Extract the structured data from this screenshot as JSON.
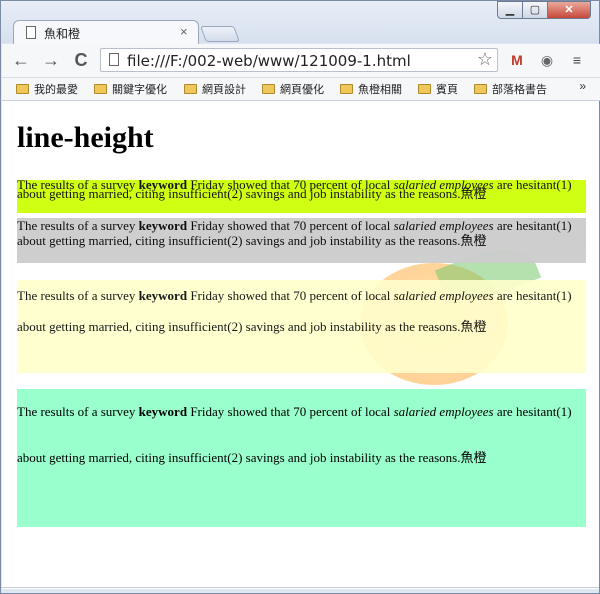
{
  "browser": {
    "tab_title": "魚和橙",
    "tab_close": "×",
    "url": "file:///F:/002-web/www/121009-1.html",
    "window_buttons": {
      "minimize": "▁",
      "maximize": "▢",
      "close": "✕"
    },
    "nav": {
      "back": "←",
      "forward": "→",
      "reload": "C"
    },
    "extensions": [
      "gmail-icon",
      "extension-icon",
      "menu-icon"
    ]
  },
  "bookmarks": [
    {
      "label": "我的最愛"
    },
    {
      "label": "關鍵字優化"
    },
    {
      "label": "網頁設計"
    },
    {
      "label": "網頁優化"
    },
    {
      "label": "魚橙相關"
    },
    {
      "label": "賓頁"
    },
    {
      "label": "部落格書告"
    }
  ],
  "bookmarks_more": "»",
  "page": {
    "heading": "line-height",
    "paragraph": {
      "before_bold": "The results of a survey ",
      "bold": "keyword",
      "middle": " Friday showed that 70 percent of local ",
      "italic": "salaried employees",
      "after_italic": " are hesitant(1) about getting married, citing insufficient(2) savings and job instability as the reasons.",
      "tail": "魚橙"
    }
  },
  "colors": {
    "p1_bg": "#ccff00",
    "p2_bg": "#cccccc",
    "p3_bg": "#ffffcc",
    "p4_bg": "#99ffcc"
  }
}
